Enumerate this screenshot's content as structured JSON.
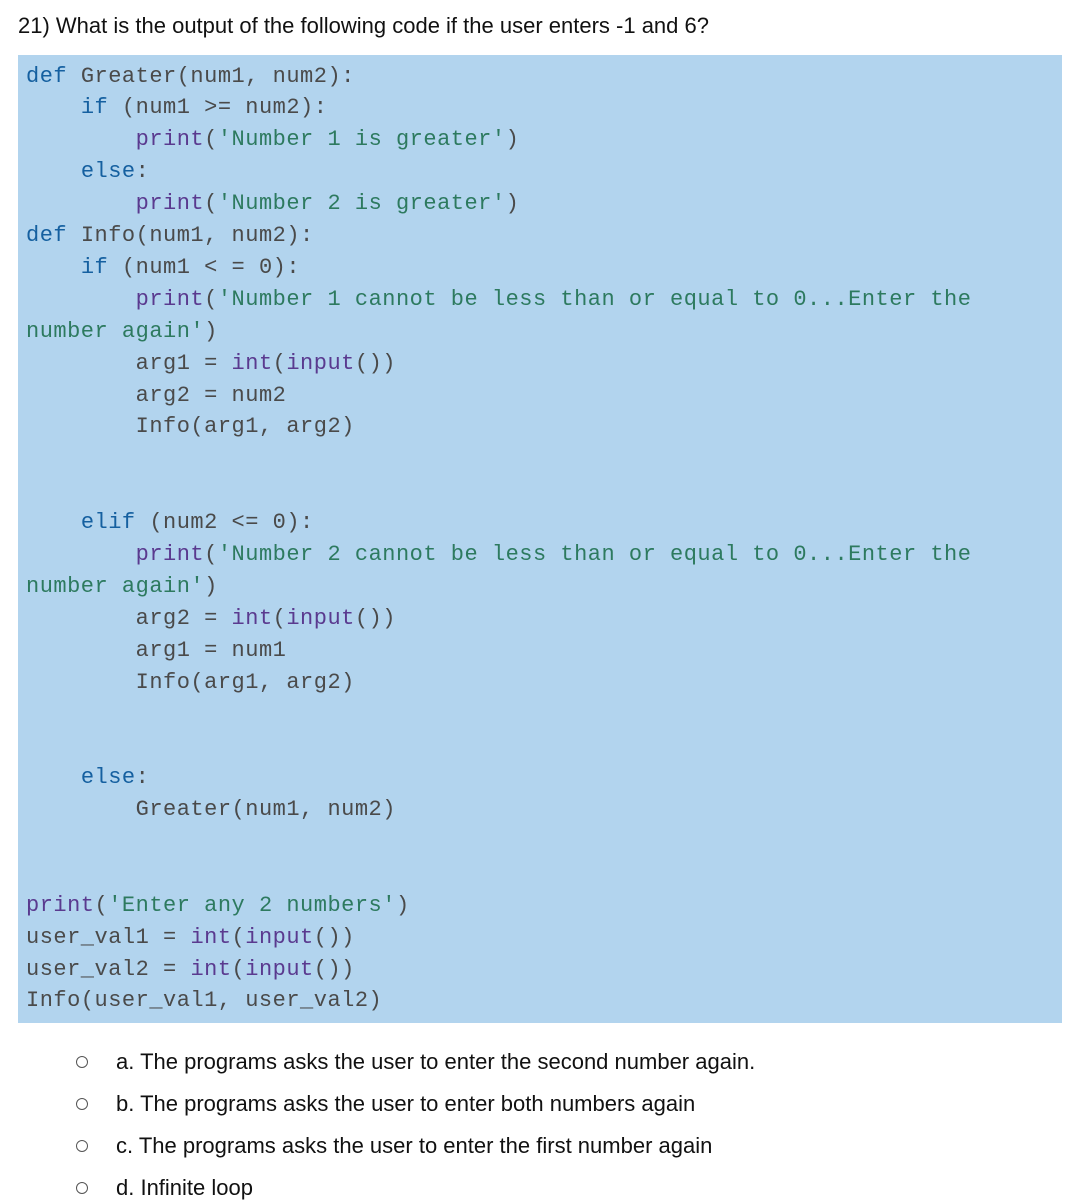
{
  "question": {
    "number": "21)",
    "text": "What is the output of the following code if the user enters -1 and 6?"
  },
  "code": {
    "kw_def1": "def",
    "fn_greater": "Greater",
    "params1": "(num1, num2):",
    "kw_if1": "if",
    "cond1": " (num1 >= num2):",
    "fn_print": "print",
    "str_n1g": "'Number 1 is greater'",
    "kw_else1": "else",
    "str_n2g": "'Number 2 is greater'",
    "kw_def2": "def",
    "fn_info": "Info",
    "params2": "(num1, num2):",
    "kw_if2": "if",
    "cond2": " (num1 < = 0):",
    "str_err1": "'Number 1 cannot be less than or equal to 0...Enter the number again'",
    "line_arg1a": "        arg1 = ",
    "fn_int": "int",
    "fn_input": "input",
    "call_input": "())",
    "line_arg2a": "        arg2 = num2",
    "line_infocall1": "        Info(arg1, arg2)",
    "kw_elif": "elif",
    "cond3": " (num2 <= 0):",
    "str_err2": "'Number 2 cannot be less than or equal to 0...Enter the number again'",
    "line_arg2b": "        arg2 = ",
    "line_arg1b": "        arg1 = num1",
    "line_infocall2": "        Info(arg1, arg2)",
    "kw_else2": "else",
    "line_greatercall": "        Greater(num1, num2)",
    "str_enter": "'Enter any 2 numbers'",
    "line_uv1": "user_val1 = ",
    "line_uv2": "user_val2 = ",
    "line_infofinal": "Info(user_val1, user_val2)"
  },
  "answers": [
    {
      "label": "a. The programs asks the user to enter the second number again."
    },
    {
      "label": "b. The programs asks the user to enter both numbers again"
    },
    {
      "label": "c. The programs asks the user to enter the first number again"
    },
    {
      "label": "d. Infinite loop"
    }
  ]
}
